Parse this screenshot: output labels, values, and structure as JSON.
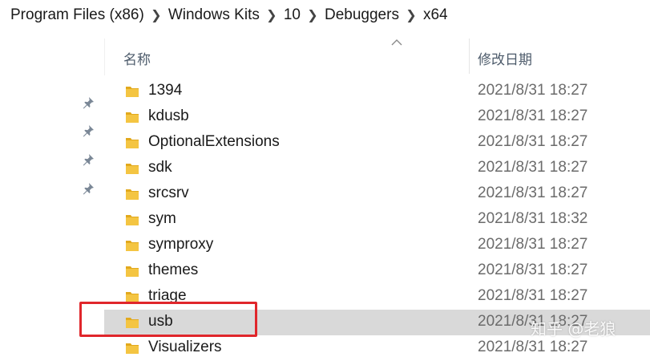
{
  "breadcrumb": {
    "items": [
      "Program Files (x86)",
      "Windows Kits",
      "10",
      "Debuggers",
      "x64"
    ]
  },
  "columns": {
    "name": "名称",
    "modified": "修改日期",
    "sort": "ascending"
  },
  "files": [
    {
      "name": "1394",
      "modified": "2021/8/31 18:27",
      "type": "folder",
      "selected": false
    },
    {
      "name": "kdusb",
      "modified": "2021/8/31 18:27",
      "type": "folder",
      "selected": false
    },
    {
      "name": "OptionalExtensions",
      "modified": "2021/8/31 18:27",
      "type": "folder",
      "selected": false
    },
    {
      "name": "sdk",
      "modified": "2021/8/31 18:27",
      "type": "folder",
      "selected": false
    },
    {
      "name": "srcsrv",
      "modified": "2021/8/31 18:27",
      "type": "folder",
      "selected": false
    },
    {
      "name": "sym",
      "modified": "2021/8/31 18:32",
      "type": "folder",
      "selected": false
    },
    {
      "name": "symproxy",
      "modified": "2021/8/31 18:27",
      "type": "folder",
      "selected": false
    },
    {
      "name": "themes",
      "modified": "2021/8/31 18:27",
      "type": "folder",
      "selected": false
    },
    {
      "name": "triage",
      "modified": "2021/8/31 18:27",
      "type": "folder",
      "selected": false
    },
    {
      "name": "usb",
      "modified": "2021/8/31 18:27",
      "type": "folder",
      "selected": true
    },
    {
      "name": "Visualizers",
      "modified": "2021/8/31 18:27",
      "type": "folder",
      "selected": false
    }
  ],
  "pins": [
    "pin-icon",
    "pin-icon",
    "pin-icon",
    "pin-icon"
  ],
  "watermark": "知乎 @老狼",
  "colors": {
    "folder": "#f4c542",
    "folder_dark": "#e2a91d",
    "selected_row": "#d9d9d9",
    "annotation": "#e0262b",
    "header_text": "#4d5b6b"
  }
}
